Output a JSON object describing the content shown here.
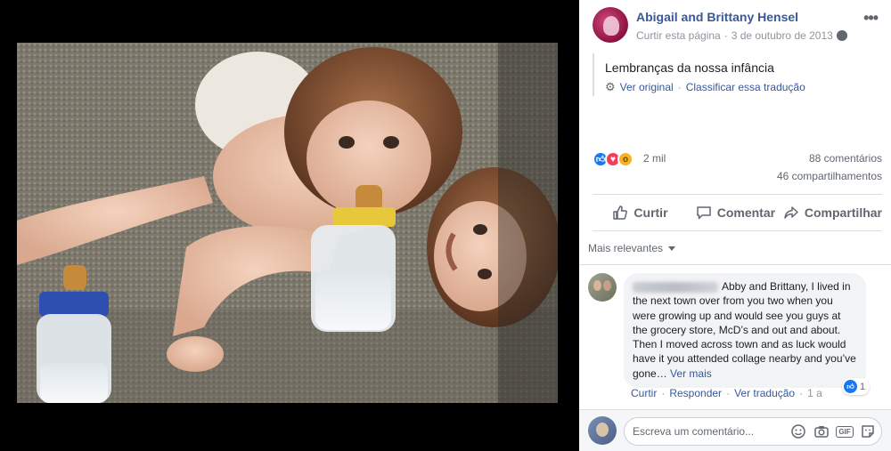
{
  "photo": {
    "alt_subject": "two toddlers with baby bottles on a carpet"
  },
  "post": {
    "page_name": "Abigail and Brittany Hensel",
    "like_page": "Curtir esta página",
    "meta_sep": "·",
    "date": "3 de outubro de 2013",
    "message": "Lembranças da nossa infância",
    "see_original": "Ver original",
    "translate_sep": "·",
    "rate_translation": "Classificar essa tradução",
    "more_menu": "•••"
  },
  "stats": {
    "reactions": "2 mil",
    "comments": "88 comentários",
    "shares": "46 compartilhamentos"
  },
  "actions": {
    "like": "Curtir",
    "comment": "Comentar",
    "share": "Compartilhar"
  },
  "comments_section": {
    "sort_label": "Mais relevantes",
    "items": [
      {
        "text": "Abby and Brittany, I lived in the next town over from you two when you were growing up and would see you guys at the grocery store, McD’s and out and about. Then I moved across town and as luck would have it you attended collage nearby and you’ve gone…",
        "see_more": "Ver mais",
        "like": "Curtir",
        "reply": "Responder",
        "see_translation": "Ver tradução",
        "time": "1 a",
        "sep": "·",
        "reaction_count": "1"
      }
    ]
  },
  "composer": {
    "placeholder": "Escreva um comentário..."
  },
  "colors": {
    "link": "#385898",
    "like_blue": "#1877f2",
    "love_red": "#f33e58",
    "wow_yellow": "#f7b125"
  }
}
